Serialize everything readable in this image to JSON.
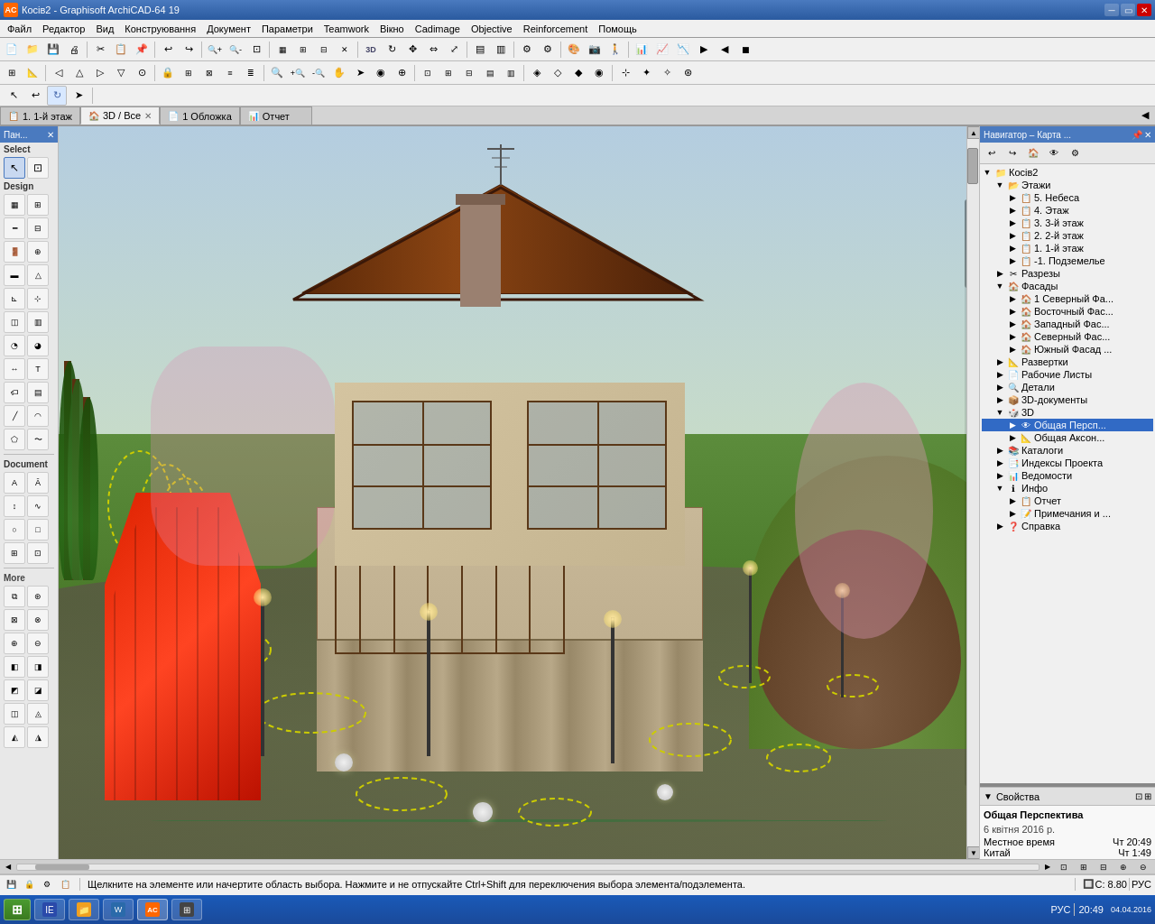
{
  "window": {
    "title": "Косів2 - Graphisoft ArchiCAD-64 19",
    "icon": "AC"
  },
  "menubar": {
    "items": [
      "Файл",
      "Редактор",
      "Вид",
      "Конструювання",
      "Документ",
      "Параметри",
      "Teamwork",
      "Вікно",
      "Cadimage",
      "Objective",
      "Reinforcement",
      "Помощь"
    ]
  },
  "tabs": [
    {
      "id": "tab1",
      "label": "1. 1-й этаж",
      "icon": "floor",
      "active": false,
      "closeable": false
    },
    {
      "id": "tab2",
      "label": "3D / Все",
      "icon": "3d",
      "active": true,
      "closeable": true
    },
    {
      "id": "tab3",
      "label": "1 Обложка",
      "icon": "cover",
      "active": false,
      "closeable": false
    },
    {
      "id": "tab4",
      "label": "Отчет",
      "icon": "report",
      "active": false,
      "closeable": false
    }
  ],
  "leftpanel": {
    "title": "Пан...",
    "select_label": "Select",
    "design_label": "Design",
    "more_label": "More",
    "tools": {
      "select_row1": [
        "arrow",
        "marquee"
      ],
      "design_row1": [
        "wall",
        "column"
      ],
      "design_row2": [
        "beam",
        "window-tool"
      ],
      "design_row3": [
        "door",
        "object"
      ],
      "design_row4": [
        "ceil",
        "roof"
      ],
      "design_row5": [
        "stair",
        "mesh"
      ],
      "design_row6": [
        "zone",
        "curtain"
      ],
      "design_row7": [
        "shell",
        "morph"
      ],
      "design_row8": [
        "dim",
        "text"
      ],
      "design_row9": [
        "label",
        "fill"
      ],
      "design_row10": [
        "line",
        "arc"
      ],
      "design_row11": [
        "poly",
        "spline"
      ],
      "more_row1": [
        "tag1",
        "tag2"
      ],
      "more_row2": [
        "tag3",
        "tag4"
      ],
      "more_row3": [
        "tag5",
        "tag6"
      ],
      "more_row4": [
        "tag7",
        "tag8"
      ],
      "more_row5": [
        "tag9",
        "tag10"
      ],
      "more_row6": [
        "tag11",
        "tag12"
      ],
      "more_row7": [
        "tag13",
        "tag14"
      ]
    }
  },
  "navigator": {
    "title": "Навигатор – Карта ...",
    "toolbar_buttons": [
      "back",
      "forward",
      "home",
      "view",
      "settings"
    ],
    "tree": [
      {
        "id": "root",
        "label": "Косів2",
        "level": 0,
        "expanded": true,
        "icon": "project"
      },
      {
        "id": "floors",
        "label": "Этажи",
        "level": 1,
        "expanded": true,
        "icon": "floors"
      },
      {
        "id": "floor5",
        "label": "5. Небеса",
        "level": 2,
        "expanded": false,
        "icon": "floor"
      },
      {
        "id": "floor4",
        "label": "4. Этаж",
        "level": 2,
        "expanded": false,
        "icon": "floor"
      },
      {
        "id": "floor3",
        "label": "3. 3-й этаж",
        "level": 2,
        "expanded": false,
        "icon": "floor"
      },
      {
        "id": "floor2",
        "label": "2. 2-й этаж",
        "level": 2,
        "expanded": false,
        "icon": "floor"
      },
      {
        "id": "floor1",
        "label": "1. 1-й этаж",
        "level": 2,
        "expanded": false,
        "icon": "floor"
      },
      {
        "id": "floor0",
        "label": "-1. Подземелье",
        "level": 2,
        "expanded": false,
        "icon": "floor"
      },
      {
        "id": "sections",
        "label": "Разрезы",
        "level": 1,
        "expanded": false,
        "icon": "section"
      },
      {
        "id": "facades",
        "label": "Фасады",
        "level": 1,
        "expanded": true,
        "icon": "facade"
      },
      {
        "id": "facade1",
        "label": "1 Северный Фа...",
        "level": 2,
        "expanded": false,
        "icon": "facade"
      },
      {
        "id": "facade2",
        "label": "Восточный Фас...",
        "level": 2,
        "expanded": false,
        "icon": "facade"
      },
      {
        "id": "facade3",
        "label": "Западный Фас...",
        "level": 2,
        "expanded": false,
        "icon": "facade"
      },
      {
        "id": "facade4",
        "label": "Северный Фас...",
        "level": 2,
        "expanded": false,
        "icon": "facade"
      },
      {
        "id": "facade5",
        "label": "Южный Фасад ...",
        "level": 2,
        "expanded": false,
        "icon": "facade"
      },
      {
        "id": "devs",
        "label": "Развертки",
        "level": 1,
        "expanded": false,
        "icon": "devs"
      },
      {
        "id": "worksheets",
        "label": "Рабочие Листы",
        "level": 1,
        "expanded": false,
        "icon": "worksheets"
      },
      {
        "id": "details",
        "label": "Детали",
        "level": 1,
        "expanded": false,
        "icon": "details"
      },
      {
        "id": "3ddocs",
        "label": "3D-документы",
        "level": 1,
        "expanded": false,
        "icon": "3ddoc"
      },
      {
        "id": "3d",
        "label": "3D",
        "level": 1,
        "expanded": true,
        "icon": "3d"
      },
      {
        "id": "3d_persp",
        "label": "Общая Персп...",
        "level": 2,
        "expanded": false,
        "icon": "3d_persp",
        "selected": true
      },
      {
        "id": "3d_axon",
        "label": "Общая Аксон...",
        "level": 2,
        "expanded": false,
        "icon": "3d_axon"
      },
      {
        "id": "catalogs",
        "label": "Каталоги",
        "level": 1,
        "expanded": false,
        "icon": "catalogs"
      },
      {
        "id": "index",
        "label": "Индексы Проекта",
        "level": 1,
        "expanded": false,
        "icon": "index"
      },
      {
        "id": "vedomosti",
        "label": "Ведомости",
        "level": 1,
        "expanded": false,
        "icon": "vedomosti"
      },
      {
        "id": "info",
        "label": "Инфо",
        "level": 1,
        "expanded": true,
        "icon": "info"
      },
      {
        "id": "report",
        "label": "Отчет",
        "level": 2,
        "expanded": false,
        "icon": "report"
      },
      {
        "id": "notes",
        "label": "Примечания и ...",
        "level": 2,
        "expanded": false,
        "icon": "notes"
      },
      {
        "id": "help",
        "label": "Справка",
        "level": 1,
        "expanded": false,
        "icon": "help"
      }
    ]
  },
  "properties": {
    "title": "Свойства",
    "current_view": "Общая Перспектива",
    "date": "6 квітня 2016 р.",
    "local_time_label": "Местное время",
    "local_time": "Чт 20:49",
    "country": "Китай",
    "time2": "Чт 1:49"
  },
  "statusbar": {
    "message": "Щелкните на элементе или начертите область выбора. Нажмите и не отпускайте Ctrl+Shift для переключения выбора элемента/подэлемента.",
    "coord": "C: 8.80",
    "lang": "РУС"
  },
  "taskbar": {
    "start": "Пуск",
    "apps": [
      {
        "icon": "windows",
        "label": ""
      },
      {
        "icon": "ie",
        "label": ""
      },
      {
        "icon": "folder",
        "label": ""
      },
      {
        "icon": "word",
        "label": ""
      },
      {
        "icon": "archicad",
        "label": ""
      },
      {
        "icon": "app6",
        "label": ""
      }
    ],
    "tray_time": "20:49",
    "tray_date": "04.04.2016",
    "language": "РУС"
  }
}
